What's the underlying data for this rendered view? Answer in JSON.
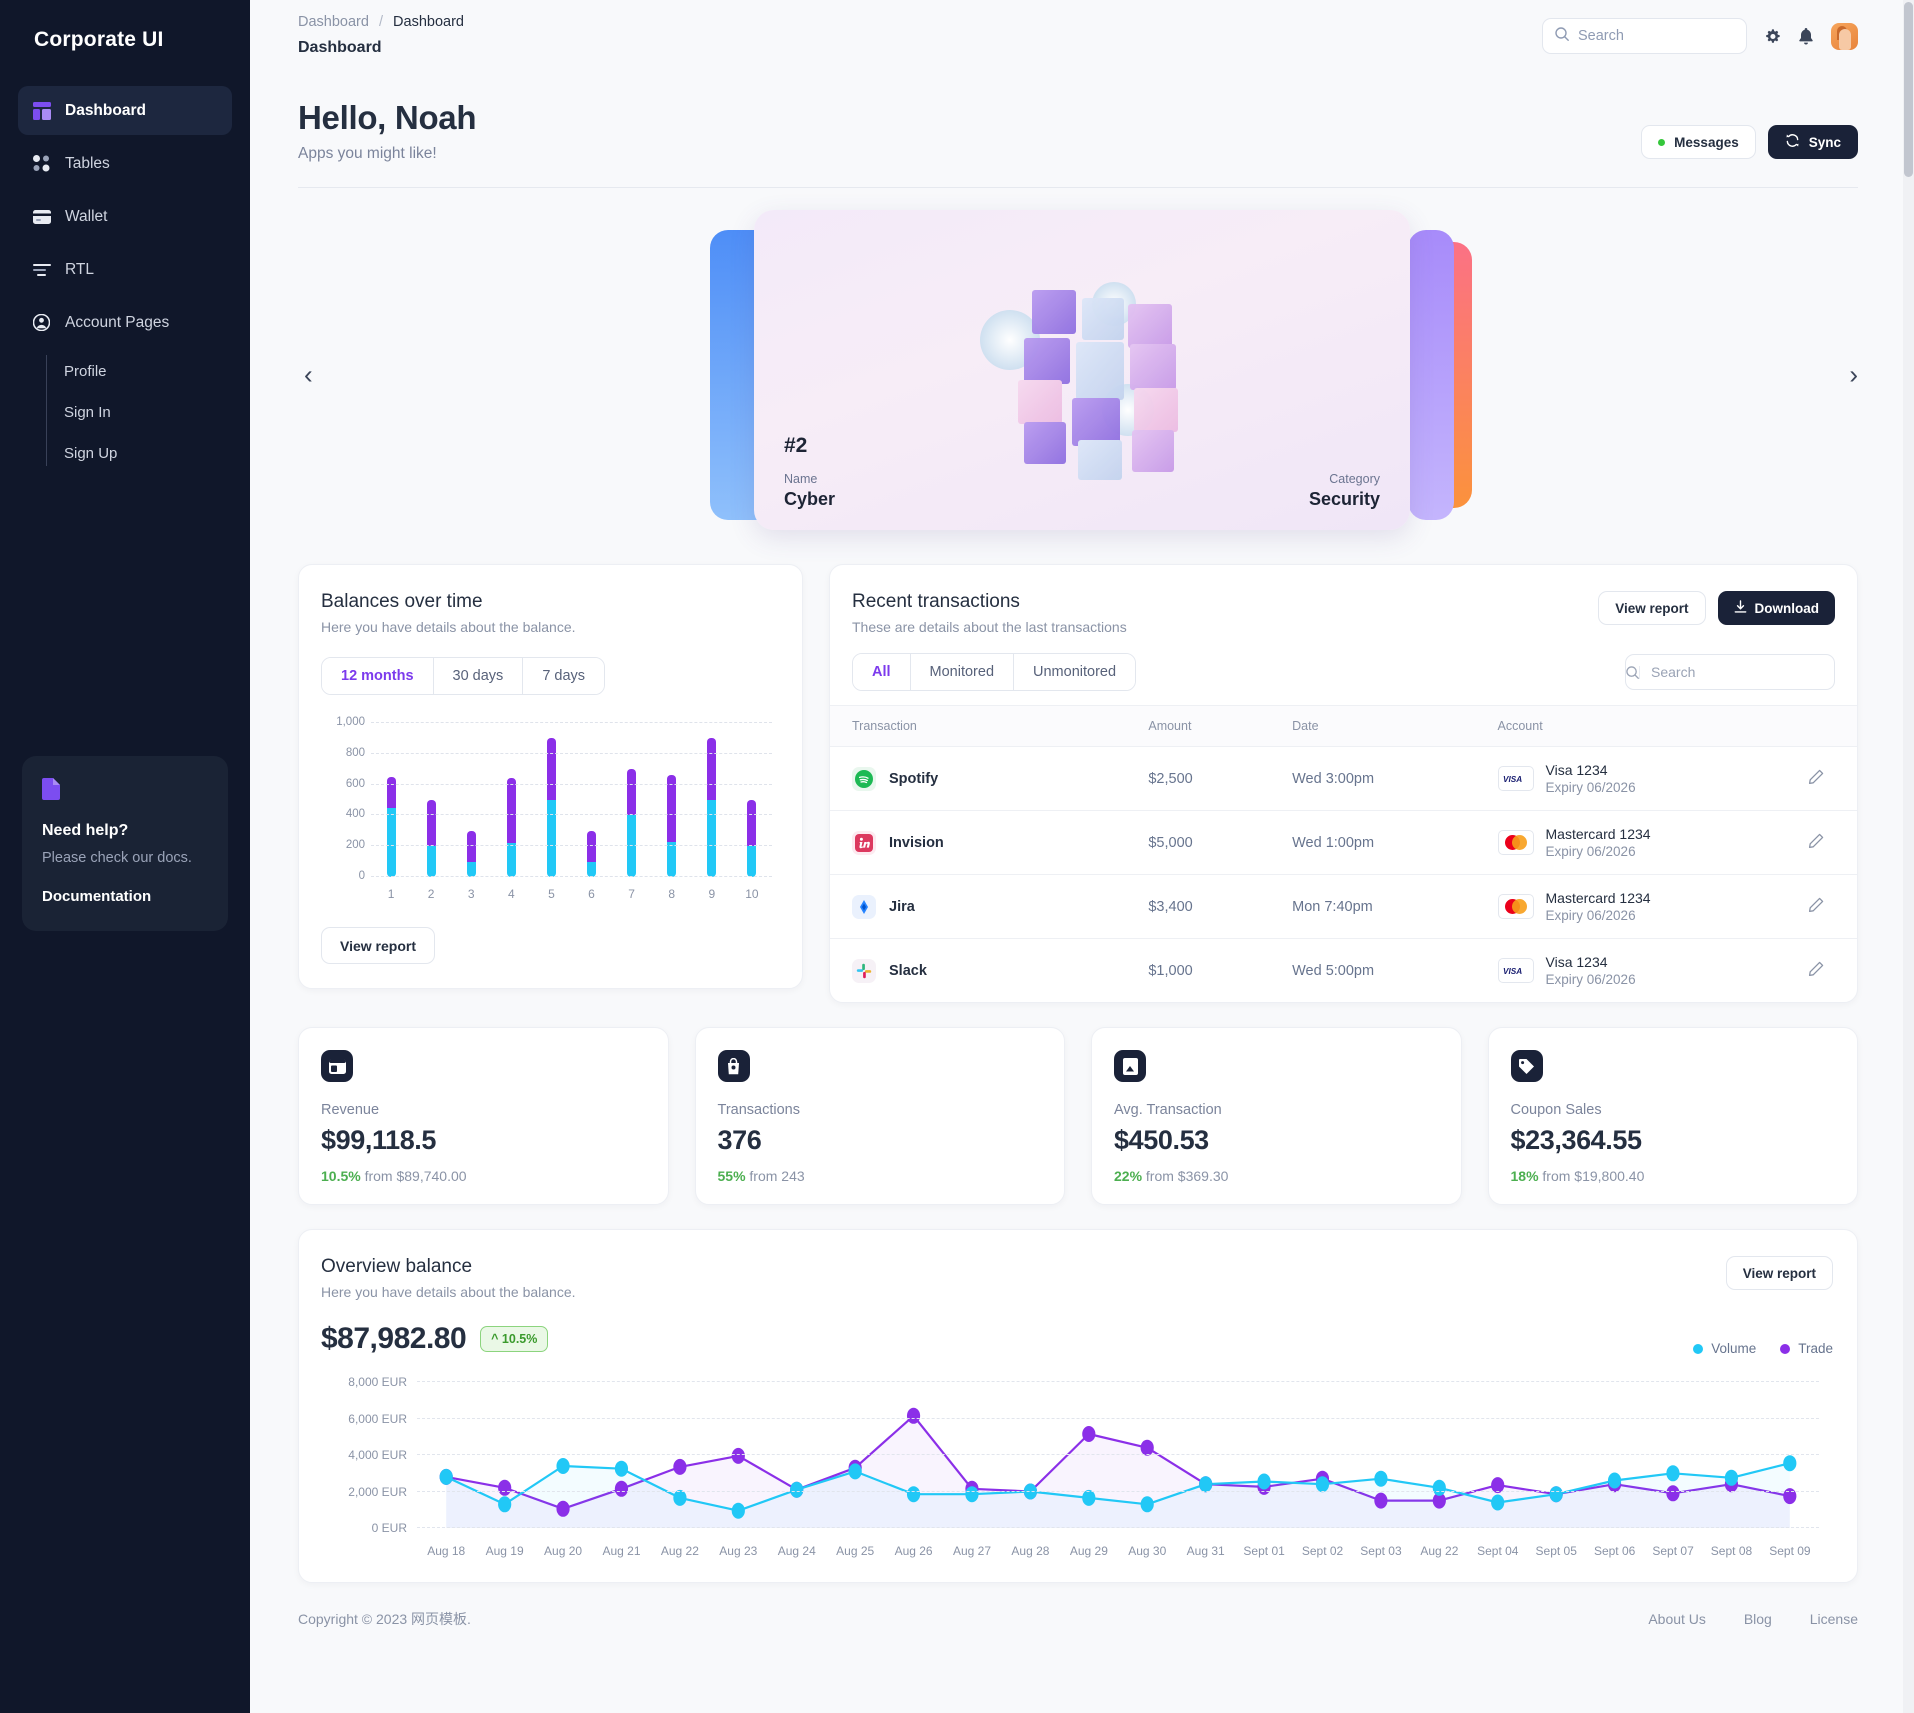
{
  "sidebar": {
    "brand": "Corporate UI",
    "items": [
      {
        "label": "Dashboard",
        "icon": "dashboard-icon",
        "active": true
      },
      {
        "label": "Tables",
        "icon": "tables-icon",
        "active": false
      },
      {
        "label": "Wallet",
        "icon": "wallet-icon",
        "active": false
      },
      {
        "label": "RTL",
        "icon": "rtl-icon",
        "active": false
      },
      {
        "label": "Account Pages",
        "icon": "account-icon",
        "active": false
      }
    ],
    "subitems": [
      "Profile",
      "Sign In",
      "Sign Up"
    ],
    "help": {
      "icon": "document-icon",
      "title": "Need help?",
      "subtitle": "Please check our docs.",
      "link": "Documentation"
    }
  },
  "topbar": {
    "breadcrumb_root": "Dashboard",
    "breadcrumb_sep": "/",
    "breadcrumb_current": "Dashboard",
    "page_title": "Dashboard",
    "search_placeholder": "Search",
    "search_value": "",
    "gear_icon": "gear-icon",
    "bell_icon": "bell-icon",
    "avatar": "avatar"
  },
  "hero": {
    "greeting": "Hello, Noah",
    "subtitle": "Apps you might like!",
    "messages_label": "Messages",
    "sync_label": "Sync"
  },
  "carousel": {
    "prev": "‹",
    "next": "›",
    "card": {
      "number": "#2",
      "name_label": "Name",
      "name_value": "Cyber",
      "category_label": "Category",
      "category_value": "Security"
    }
  },
  "balances": {
    "title": "Balances over time",
    "subtitle": "Here you have details about the balance.",
    "ranges": [
      "12 months",
      "30 days",
      "7 days"
    ],
    "active_range": "12 months",
    "view_report": "View report"
  },
  "transactions": {
    "title": "Recent transactions",
    "subtitle": "These are details about the last transactions",
    "view_report": "View report",
    "download": "Download",
    "filters": [
      "All",
      "Monitored",
      "Unmonitored"
    ],
    "active_filter": "All",
    "search_placeholder": "Search",
    "search_value": "",
    "columns": [
      "Transaction",
      "Amount",
      "Date",
      "Account"
    ],
    "rows": [
      {
        "name": "Spotify",
        "icon": "spotify-icon",
        "amount": "$2,500",
        "date": "Wed 3:00pm",
        "card_brand": "VISA",
        "card": "Visa 1234",
        "expiry": "Expiry 06/2026",
        "edit": "edit-icon"
      },
      {
        "name": "Invision",
        "icon": "invision-icon",
        "amount": "$5,000",
        "date": "Wed 1:00pm",
        "card_brand": "MC",
        "card": "Mastercard 1234",
        "expiry": "Expiry 06/2026",
        "edit": "edit-icon"
      },
      {
        "name": "Jira",
        "icon": "jira-icon",
        "amount": "$3,400",
        "date": "Mon 7:40pm",
        "card_brand": "MC",
        "card": "Mastercard 1234",
        "expiry": "Expiry 06/2026",
        "edit": "edit-icon"
      },
      {
        "name": "Slack",
        "icon": "slack-icon",
        "amount": "$1,000",
        "date": "Wed 5:00pm",
        "card_brand": "VISA",
        "card": "Visa 1234",
        "expiry": "Expiry 06/2026",
        "edit": "edit-icon"
      }
    ]
  },
  "stats": [
    {
      "icon": "wallet-card-icon",
      "label": "Revenue",
      "value": "$99,118.5",
      "delta": "10.5%",
      "from": "from $89,740.00"
    },
    {
      "icon": "bag-icon",
      "label": "Transactions",
      "value": "376",
      "delta": "55%",
      "from": "from 243"
    },
    {
      "icon": "chart-icon",
      "label": "Avg. Transaction",
      "value": "$450.53",
      "delta": "22%",
      "from": "from $369.30"
    },
    {
      "icon": "tag-icon",
      "label": "Coupon Sales",
      "value": "$23,364.55",
      "delta": "18%",
      "from": "from $19,800.40"
    }
  ],
  "overview": {
    "title": "Overview balance",
    "subtitle": "Here you have details about the balance.",
    "view_report": "View report",
    "amount": "$87,982.80",
    "badge": "^ 10.5%"
  },
  "footer": {
    "copyright": "Copyright © 2023 网页模板.",
    "links": [
      "About Us",
      "Blog",
      "License"
    ]
  },
  "colors": {
    "sidebar_bg": "#10172a",
    "accent_purple": "#7c3aed",
    "series_volume": "#21c8f6",
    "series_trade": "#8b2fe8",
    "positive_green": "#4caf50",
    "dark_button": "#1a2238"
  },
  "chart_data": [
    {
      "type": "bar",
      "title": "Balances over time",
      "subtitle": "Here you have details about the balance.",
      "categories": [
        "1",
        "2",
        "3",
        "4",
        "5",
        "6",
        "7",
        "8",
        "9",
        "10"
      ],
      "stacked": true,
      "series": [
        {
          "name": "Volume",
          "color": "#21c8f6",
          "values": [
            450,
            200,
            100,
            220,
            500,
            100,
            400,
            230,
            500,
            200
          ]
        },
        {
          "name": "Trade",
          "color": "#8b2fe8",
          "values": [
            200,
            300,
            200,
            420,
            400,
            200,
            300,
            430,
            400,
            300
          ]
        }
      ],
      "totals": [
        650,
        500,
        300,
        640,
        900,
        300,
        700,
        660,
        900,
        500
      ],
      "ylim": [
        0,
        1000
      ],
      "yticks": [
        "0",
        "200",
        "400",
        "600",
        "800",
        "1,000"
      ],
      "xlabel": "",
      "ylabel": "",
      "grid": true,
      "legend": "none"
    },
    {
      "type": "line",
      "title": "Overview balance",
      "subtitle": "Here you have details about the balance.",
      "x": [
        "Aug 18",
        "Aug 19",
        "Aug 20",
        "Aug 21",
        "Aug 22",
        "Aug 23",
        "Aug 24",
        "Aug 25",
        "Aug 26",
        "Aug 27",
        "Aug 28",
        "Aug 29",
        "Aug 30",
        "Aug 31",
        "Sept 01",
        "Sept 02",
        "Sept 03",
        "Aug 22",
        "Sept 04",
        "Sept 05",
        "Sept 06",
        "Sept 07",
        "Sept 08",
        "Sept 09"
      ],
      "series": [
        {
          "name": "Volume",
          "color": "#21c8f6",
          "values": [
            2800,
            1300,
            3400,
            3250,
            1650,
            950,
            2100,
            3100,
            1850,
            1850,
            2000,
            1650,
            1300,
            2400,
            2550,
            2400,
            2700,
            2200,
            1400,
            1850,
            2600,
            3000,
            2750,
            3550
          ]
        },
        {
          "name": "Trade",
          "color": "#8b2fe8",
          "values": [
            2800,
            2200,
            1050,
            2150,
            3350,
            3950,
            2100,
            3300,
            6150,
            2150,
            2000,
            5150,
            4400,
            2400,
            2250,
            2700,
            1500,
            1500,
            2350,
            1850,
            2400,
            1900,
            2400,
            1750
          ]
        }
      ],
      "ylim": [
        0,
        8000
      ],
      "yticks": [
        "0 EUR",
        "2,000 EUR",
        "4,000 EUR",
        "6,000 EUR",
        "8,000 EUR"
      ],
      "xlabel": "",
      "ylabel": "EUR",
      "grid": true,
      "legend": "top-right"
    }
  ]
}
